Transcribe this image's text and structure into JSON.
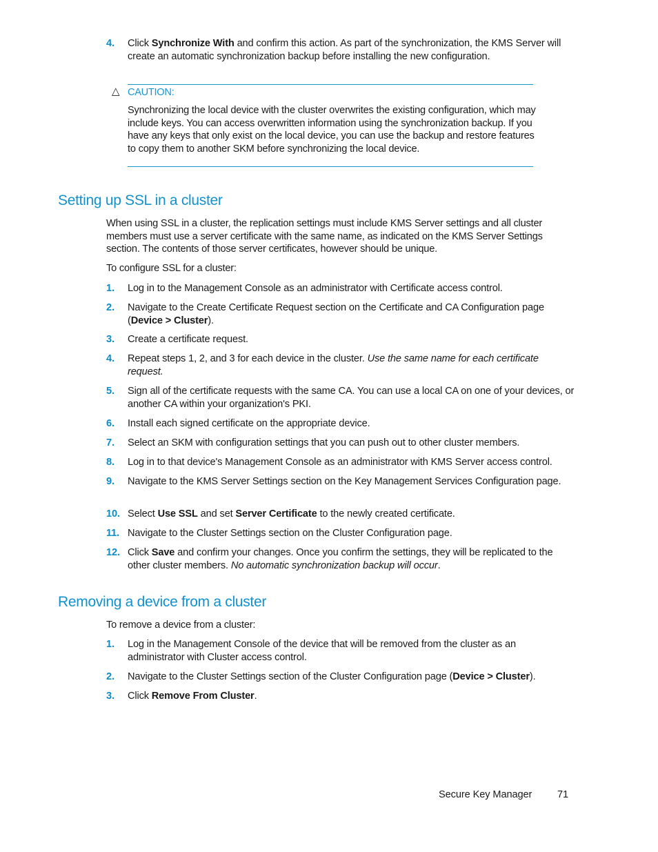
{
  "top_step": {
    "number": "4.",
    "pre": "Click ",
    "bold": "Synchronize With",
    "post": " and confirm this action. As part of the synchronization, the KMS Server will create an automatic synchronization backup before installing the new configuration."
  },
  "caution": {
    "icon": "warning-triangle-icon",
    "label": "CAUTION:",
    "text": "Synchronizing the local device with the cluster overwrites the existing configuration, which may include keys. You can access overwritten information using the synchronization backup. If you have any keys that only exist on the local device, you can use the backup and restore features to copy them to another SKM before synchronizing the local device."
  },
  "ssl_section": {
    "heading": "Setting up SSL in a cluster",
    "intro": "When using SSL in a cluster, the replication settings must include KMS Server settings and all cluster members must use a server certificate with the same name, as indicated on the KMS Server Settings section. The contents of those server certificates, however should be unique.",
    "lead": "To configure SSL for a cluster:",
    "steps": [
      {
        "number": "1.",
        "parts": [
          {
            "t": "Log in to the Management Console as an administrator with Certificate access control."
          }
        ]
      },
      {
        "number": "2.",
        "parts": [
          {
            "t": "Navigate to the Create Certificate Request section on the Certificate and CA Configuration page ("
          },
          {
            "t": "Device > Cluster",
            "style": "bold"
          },
          {
            "t": ")."
          }
        ]
      },
      {
        "number": "3.",
        "parts": [
          {
            "t": "Create a certificate request."
          }
        ]
      },
      {
        "number": "4.",
        "parts": [
          {
            "t": "Repeat steps 1, 2, and 3 for each device in the cluster. "
          },
          {
            "t": "Use the same name for each certificate request.",
            "style": "italic"
          }
        ]
      },
      {
        "number": "5.",
        "parts": [
          {
            "t": "Sign all of the certificate requests with the same CA. You can use a local CA on one of your devices, or another CA within your organization's PKI."
          }
        ]
      },
      {
        "number": "6.",
        "parts": [
          {
            "t": "Install each signed certificate on the appropriate device."
          }
        ]
      },
      {
        "number": "7.",
        "parts": [
          {
            "t": "Select an SKM with configuration settings that you can push out to other cluster members."
          }
        ]
      },
      {
        "number": "8.",
        "parts": [
          {
            "t": "Log in to that device's Management Console as an administrator with KMS Server access control."
          }
        ]
      },
      {
        "number": "9.",
        "parts": [
          {
            "t": "Navigate to the KMS Server Settings section on the Key Management Services Configuration page."
          }
        ]
      },
      {
        "number": "10.",
        "parts": [
          {
            "t": "Select "
          },
          {
            "t": "Use SSL",
            "style": "bold"
          },
          {
            "t": " and set "
          },
          {
            "t": "Server Certificate",
            "style": "bold"
          },
          {
            "t": " to the newly created certificate."
          }
        ]
      },
      {
        "number": "11.",
        "parts": [
          {
            "t": "Navigate to the Cluster Settings section on the Cluster Configuration page."
          }
        ]
      },
      {
        "number": "12.",
        "parts": [
          {
            "t": "Click "
          },
          {
            "t": "Save",
            "style": "bold"
          },
          {
            "t": " and confirm your changes. Once you confirm the settings, they will be replicated to the other cluster members. "
          },
          {
            "t": "No automatic synchronization backup will occur",
            "style": "italic"
          },
          {
            "t": "."
          }
        ]
      }
    ]
  },
  "remove_section": {
    "heading": "Removing a device from a cluster",
    "lead": "To remove a device from a cluster:",
    "steps": [
      {
        "number": "1.",
        "parts": [
          {
            "t": "Log in the Management Console of the device that will be removed from the cluster as an administrator with Cluster access control."
          }
        ]
      },
      {
        "number": "2.",
        "parts": [
          {
            "t": "Navigate to the Cluster Settings section of the Cluster Configuration page ("
          },
          {
            "t": "Device > Cluster",
            "style": "bold"
          },
          {
            "t": ")."
          }
        ]
      },
      {
        "number": "3.",
        "parts": [
          {
            "t": "Click "
          },
          {
            "t": "Remove From Cluster",
            "style": "bold"
          },
          {
            "t": "."
          }
        ]
      }
    ]
  },
  "footer": {
    "title": "Secure Key Manager",
    "page_number": "71"
  },
  "colors": {
    "accent": "#1191cf",
    "caution_rule": "#1796d0",
    "text": "#1a1a1a"
  }
}
